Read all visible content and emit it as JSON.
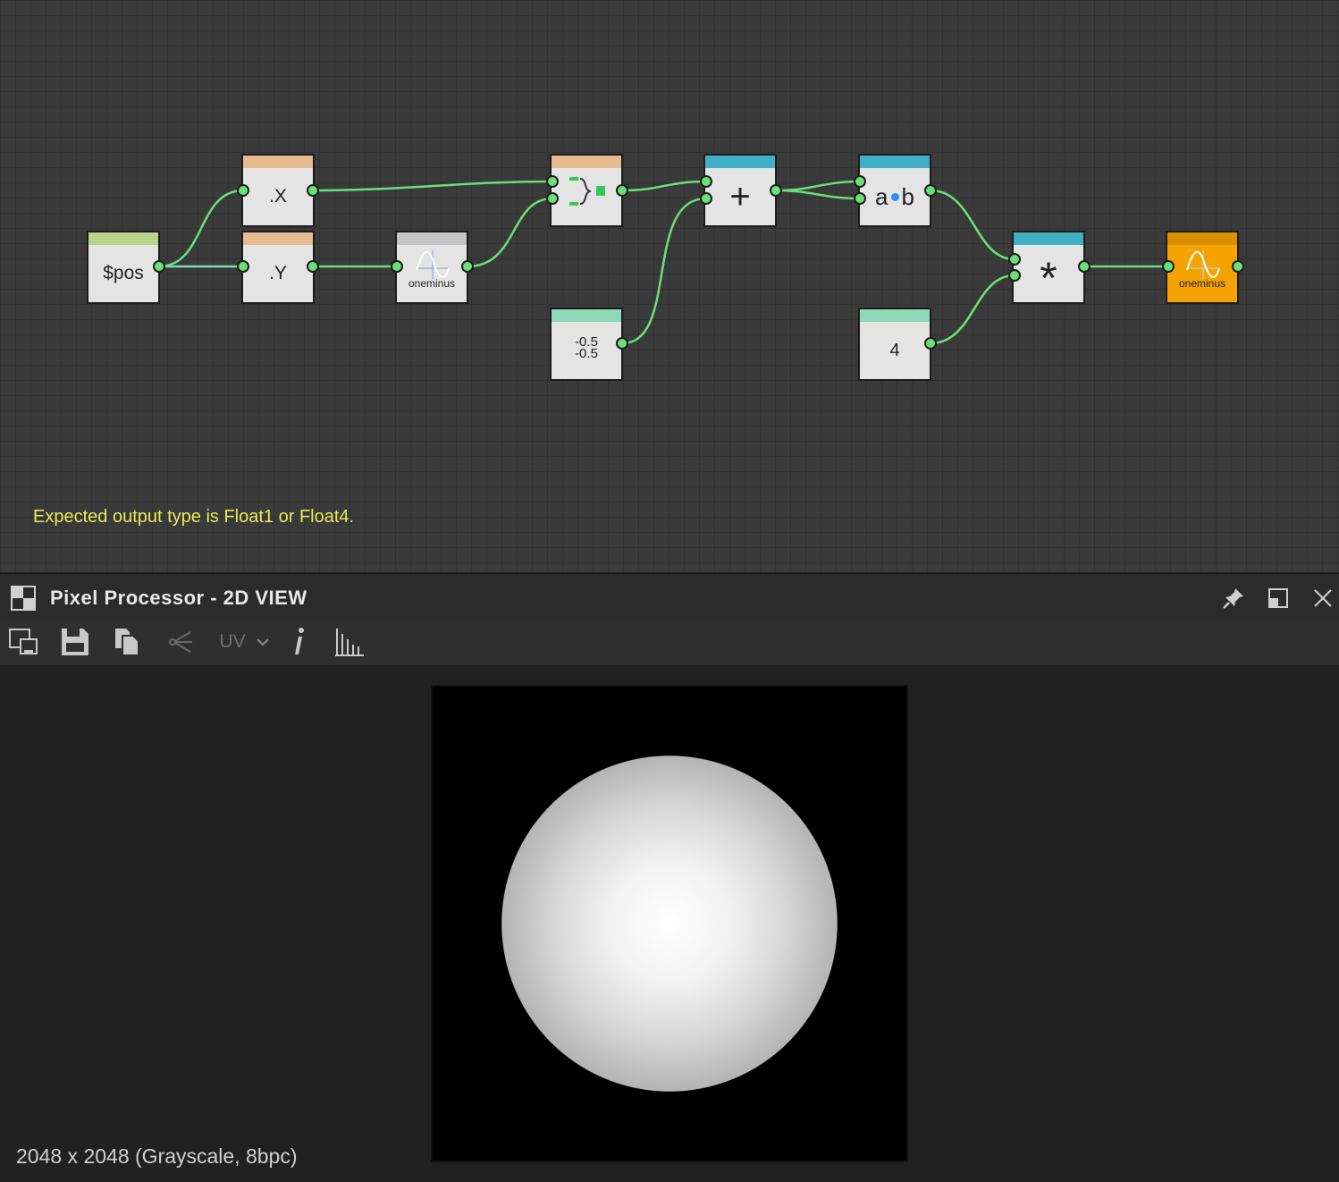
{
  "graph": {
    "nodes": {
      "pos": {
        "label": "$pos",
        "color": "#b8d38a"
      },
      "x": {
        "label": ".X",
        "color": "#e6bb90"
      },
      "y": {
        "label": ".Y",
        "color": "#e6bb90"
      },
      "oneminus1": {
        "label": "oneminus",
        "color": "#c4c4c4"
      },
      "vector": {
        "label": "",
        "color": "#e6bb90"
      },
      "const_vec": {
        "line1": "-0.5",
        "line2": "-0.5",
        "color": "#8fd8b8"
      },
      "add": {
        "label": "+",
        "color": "#3fb0c6"
      },
      "dot": {
        "label_a": "a",
        "label_b": "b",
        "color": "#3fb0c6"
      },
      "const4": {
        "label": "4",
        "color": "#8fd8b8"
      },
      "multiply": {
        "label": "*",
        "color": "#3fb0c6"
      },
      "oneminus2": {
        "label": "oneminus",
        "color": "#f5a300"
      }
    },
    "error_message": "Expected output type is Float1 or Float4.",
    "wire_color": "#6be07a"
  },
  "panel": {
    "title": "Pixel Processor - 2D VIEW",
    "toolbar": {
      "uv_label": "UV"
    },
    "status": "2048 x 2048 (Grayscale, 8bpc)"
  }
}
